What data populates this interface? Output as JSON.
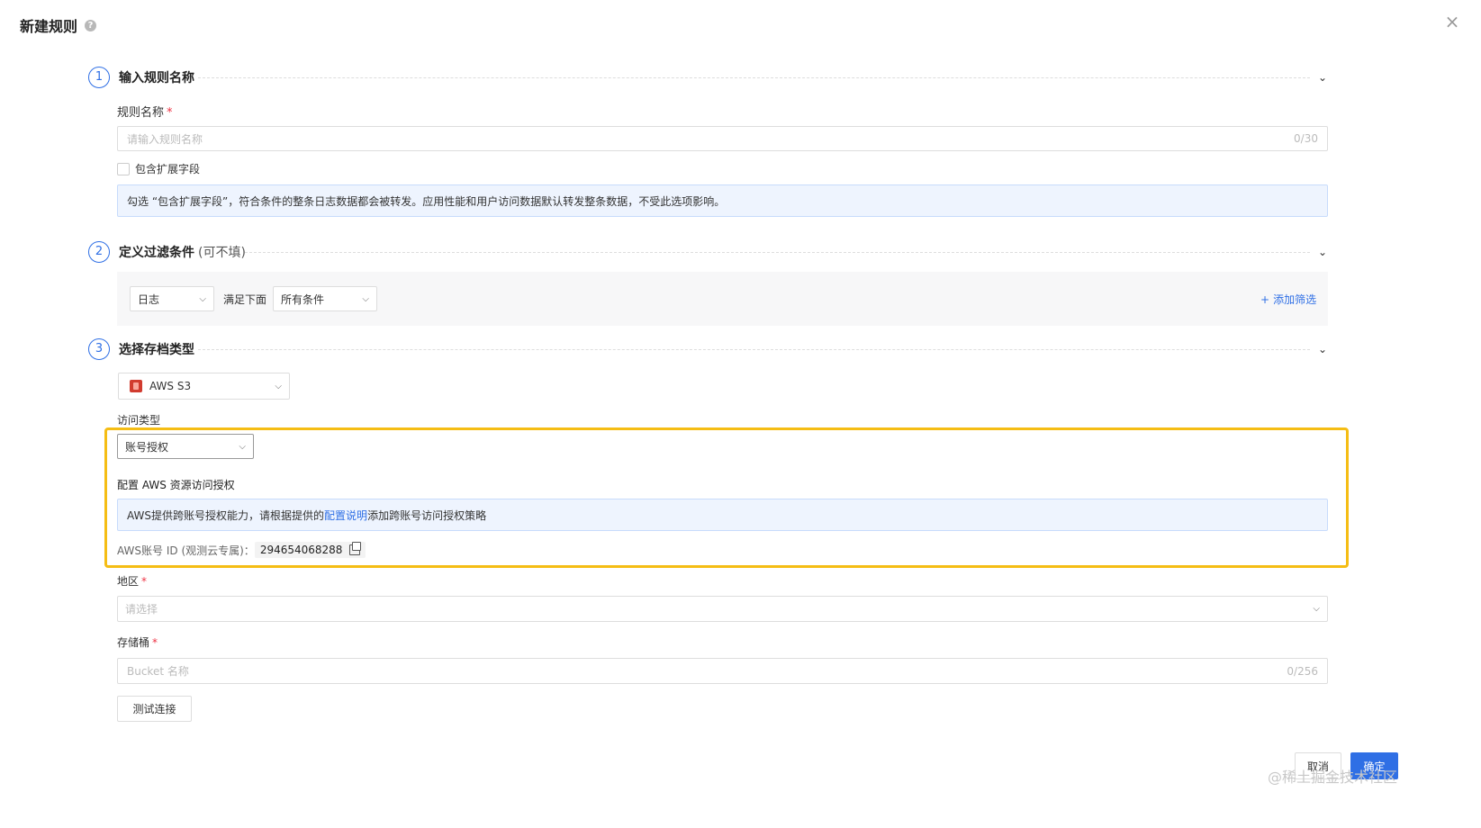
{
  "header": {
    "title": "新建规则",
    "help_icon": "question-icon",
    "close_icon": "close-icon"
  },
  "step1": {
    "num": "1",
    "title": "输入规则名称",
    "name_label": "规则名称",
    "required_mark": "*",
    "name_placeholder": "请输入规则名称",
    "name_counter": "0/30",
    "checkbox_label": "包含扩展字段",
    "info": "勾选 “包含扩展字段”，符合条件的整条日志数据都会被转发。应用性能和用户访问数据默认转发整条数据，不受此选项影响。"
  },
  "step2": {
    "num": "2",
    "title": "定义过滤条件",
    "subtitle": "(可不填)",
    "source_select": "日志",
    "match_text": "满足下面",
    "condition_select": "所有条件",
    "add_filter": "添加筛选",
    "add_icon": "plus-icon"
  },
  "step3": {
    "num": "3",
    "title": "选择存档类型",
    "archive_select": "AWS S3",
    "access_type_label": "访问类型",
    "access_select": "账号授权",
    "config_title": "配置 AWS 资源访问授权",
    "info_prefix": "AWS提供跨账号授权能力，请根据提供的",
    "info_link": "配置说明",
    "info_suffix": "添加跨账号访问授权策略",
    "account_label": "AWS账号 ID (观测云专属)：",
    "account_id": "294654068288",
    "region_label": "地区",
    "region_placeholder": "请选择",
    "bucket_label": "存储桶",
    "bucket_placeholder": "Bucket 名称",
    "bucket_counter": "0/256",
    "test_button": "测试连接"
  },
  "footer": {
    "cancel": "取消",
    "confirm": "确定"
  },
  "watermark": "@稀土掘金技术社区",
  "colors": {
    "accent": "#2f6fe5",
    "highlight": "#f5bd14",
    "required": "#e34",
    "info_bg": "#eef4fe"
  }
}
